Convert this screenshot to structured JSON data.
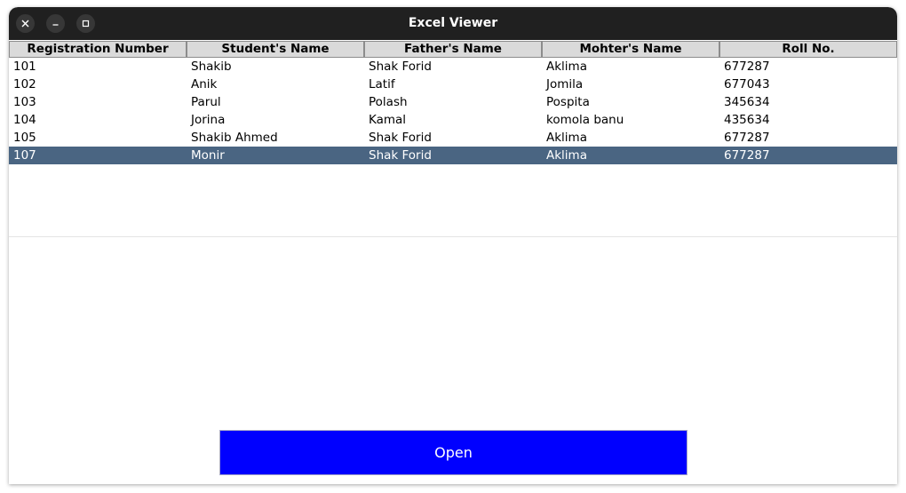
{
  "window": {
    "title": "Excel Viewer",
    "controls": [
      "close-icon",
      "minimize-icon",
      "maximize-icon"
    ]
  },
  "table": {
    "columns": [
      "Registration Number",
      "Student's Name",
      "Father's Name",
      "Mohter's Name",
      "Roll No."
    ],
    "rows": [
      [
        "101",
        "Shakib",
        "Shak Forid",
        "Aklima",
        "677287"
      ],
      [
        "102",
        "Anik",
        "Latif",
        "Jomila",
        "677043"
      ],
      [
        "103",
        "Parul",
        "Polash",
        "Pospita",
        "345634"
      ],
      [
        "104",
        "Jorina",
        "Kamal",
        "komola banu",
        "435634"
      ],
      [
        "105",
        "Shakib Ahmed",
        "Shak Forid",
        "Aklima",
        "677287"
      ],
      [
        "107",
        "Monir",
        "Shak Forid",
        "Aklima",
        "677287"
      ]
    ],
    "selected_row_index": 5
  },
  "open_button": {
    "label": "Open"
  },
  "colors": {
    "titlebar": "#202020",
    "header_bg": "#dadada",
    "selection": "#4a6582",
    "button_bg": "#0000ff",
    "button_text": "#ffffff"
  }
}
